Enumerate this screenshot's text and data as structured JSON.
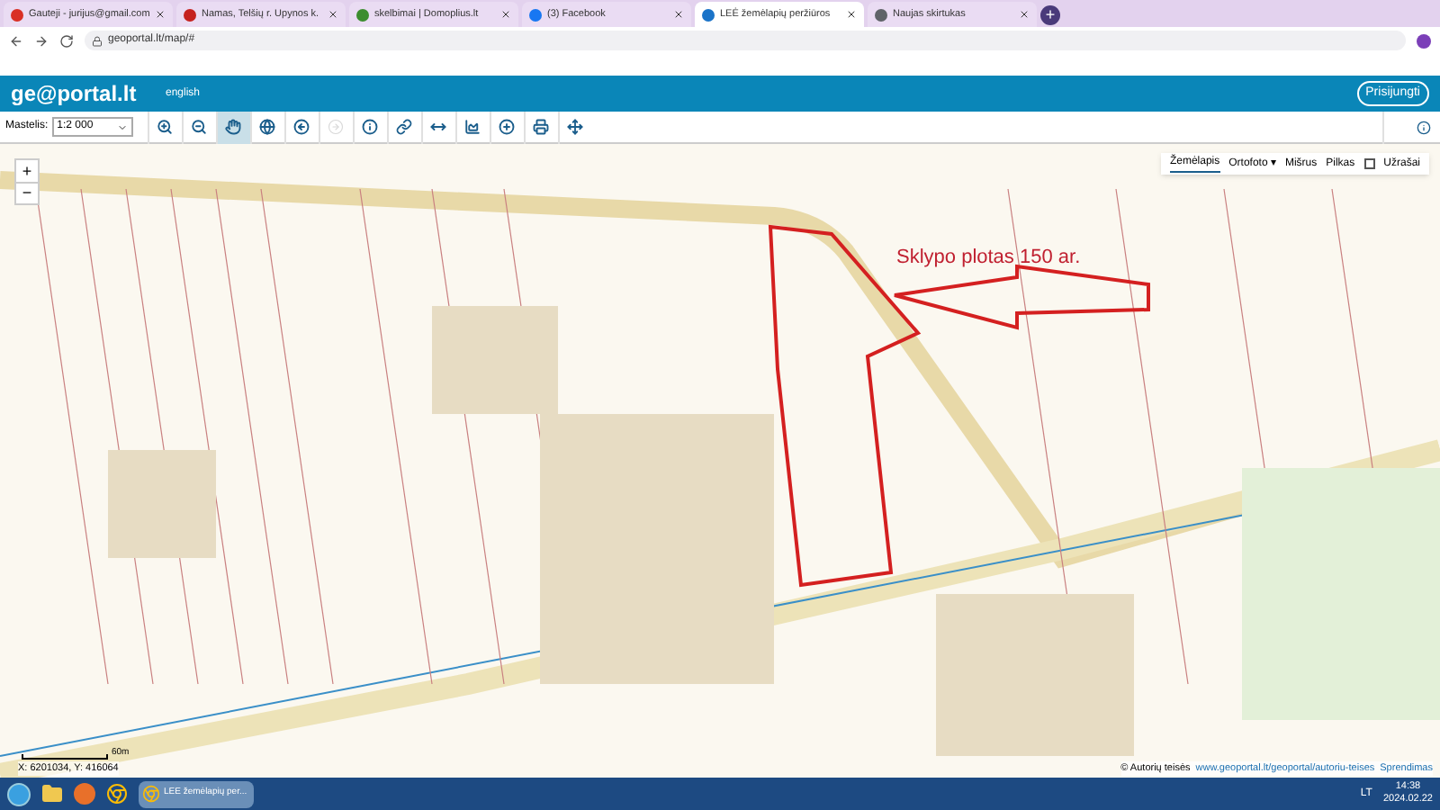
{
  "browser": {
    "tabs": [
      {
        "title": "Gauteji - jurijus@gmail.com",
        "selected": false,
        "color": "#d93025"
      },
      {
        "title": "Namas, Telšių r. Upynos k.",
        "selected": false,
        "color": "#c5221f"
      },
      {
        "title": "skelbimai | Domoplius.lt",
        "selected": false,
        "color": "#3c8d2f"
      },
      {
        "title": "(3) Facebook",
        "selected": false,
        "color": "#1877f2"
      },
      {
        "title": "LEĖ žemėlapių peržiūros",
        "selected": true,
        "color": "#1a73c8"
      },
      {
        "title": "Naujas skirtukas",
        "selected": false,
        "color": "#5f6368"
      }
    ],
    "new_tab": "+",
    "address": "geoportal.lt/map/#"
  },
  "header": {
    "logo": "ge@portal.lt",
    "language": "english",
    "login": "Prisijungti"
  },
  "toolbar": {
    "scale_label": "Mastelis:",
    "scale_value": "1:2 000",
    "tools": [
      {
        "kind": "zoom-in",
        "selected": false,
        "disabled": false
      },
      {
        "kind": "zoom-out",
        "selected": false,
        "disabled": false
      },
      {
        "kind": "pan",
        "selected": true,
        "disabled": false
      },
      {
        "kind": "globe",
        "selected": false,
        "disabled": false
      },
      {
        "kind": "back",
        "selected": false,
        "disabled": false
      },
      {
        "kind": "forward",
        "selected": false,
        "disabled": true
      },
      {
        "kind": "info",
        "selected": false,
        "disabled": false
      },
      {
        "kind": "link",
        "selected": false,
        "disabled": false
      },
      {
        "kind": "measure",
        "selected": false,
        "disabled": false
      },
      {
        "kind": "profile",
        "selected": false,
        "disabled": false
      },
      {
        "kind": "add",
        "selected": false,
        "disabled": false
      },
      {
        "kind": "print",
        "selected": false,
        "disabled": false
      },
      {
        "kind": "locate",
        "selected": false,
        "disabled": false
      }
    ]
  },
  "map": {
    "zoom_in": "+",
    "zoom_out": "−",
    "layers": [
      {
        "label": "Žemėlapis",
        "selected": true
      },
      {
        "label": "Ortofoto ▾",
        "selected": false
      },
      {
        "label": "Mišrus",
        "selected": false
      },
      {
        "label": "Pilkas",
        "selected": false
      }
    ],
    "labels_toggle": {
      "label": "Užrašai",
      "checked": false
    },
    "annotation": "Sklypo plotas 150 ar.",
    "scale_bar": "60m",
    "coordinates": "X: 6201034, Y: 416064",
    "attribution": "© Autorių teisės",
    "attribution_link": "www.geoportal.lt/geoportal/autoriu-teises",
    "decision": "Sprendimas"
  },
  "taskbar": {
    "window": "LEE žemėlapių per...",
    "language": "LT",
    "time": "14:38",
    "date": "2024.02.22"
  }
}
